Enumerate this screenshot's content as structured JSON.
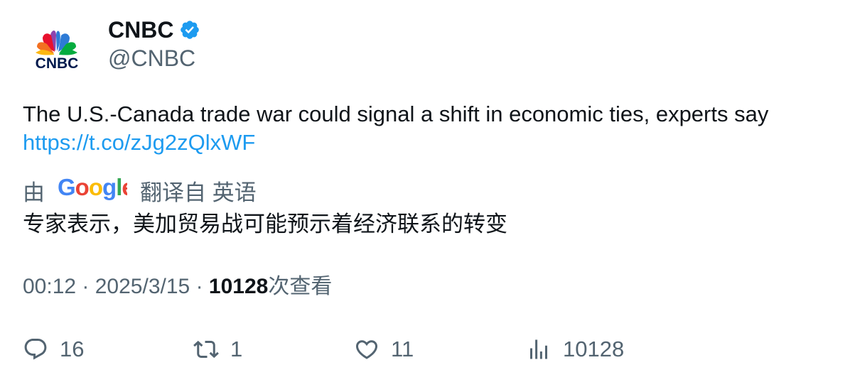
{
  "author": {
    "display_name": "CNBC",
    "handle": "@CNBC",
    "verified": true,
    "avatar_logo_text": "CNBC"
  },
  "tweet": {
    "text": "The U.S.-Canada trade war could signal a shift in economic ties, experts say",
    "link": "https://t.co/zJg2zQlxWF"
  },
  "translation": {
    "prefix": "由",
    "provider": "Google",
    "suffix": "翻译自 英语",
    "text": "专家表示，美加贸易战可能预示着经济联系的转变"
  },
  "meta": {
    "time": "00:12",
    "separator": "·",
    "date": "2025/3/15",
    "views_count": "10128",
    "views_label": "次查看"
  },
  "actions": {
    "replies": "16",
    "retweets": "1",
    "likes": "11",
    "views": "10128"
  },
  "colors": {
    "link": "#1d9bf0",
    "verified_badge": "#1d9bf0",
    "secondary_text": "#536471",
    "primary_text": "#0f1419"
  },
  "icons": [
    "verified-badge-icon",
    "reply-icon",
    "retweet-icon",
    "like-icon",
    "views-icon",
    "google-logo",
    "cnbc-peacock-logo"
  ]
}
